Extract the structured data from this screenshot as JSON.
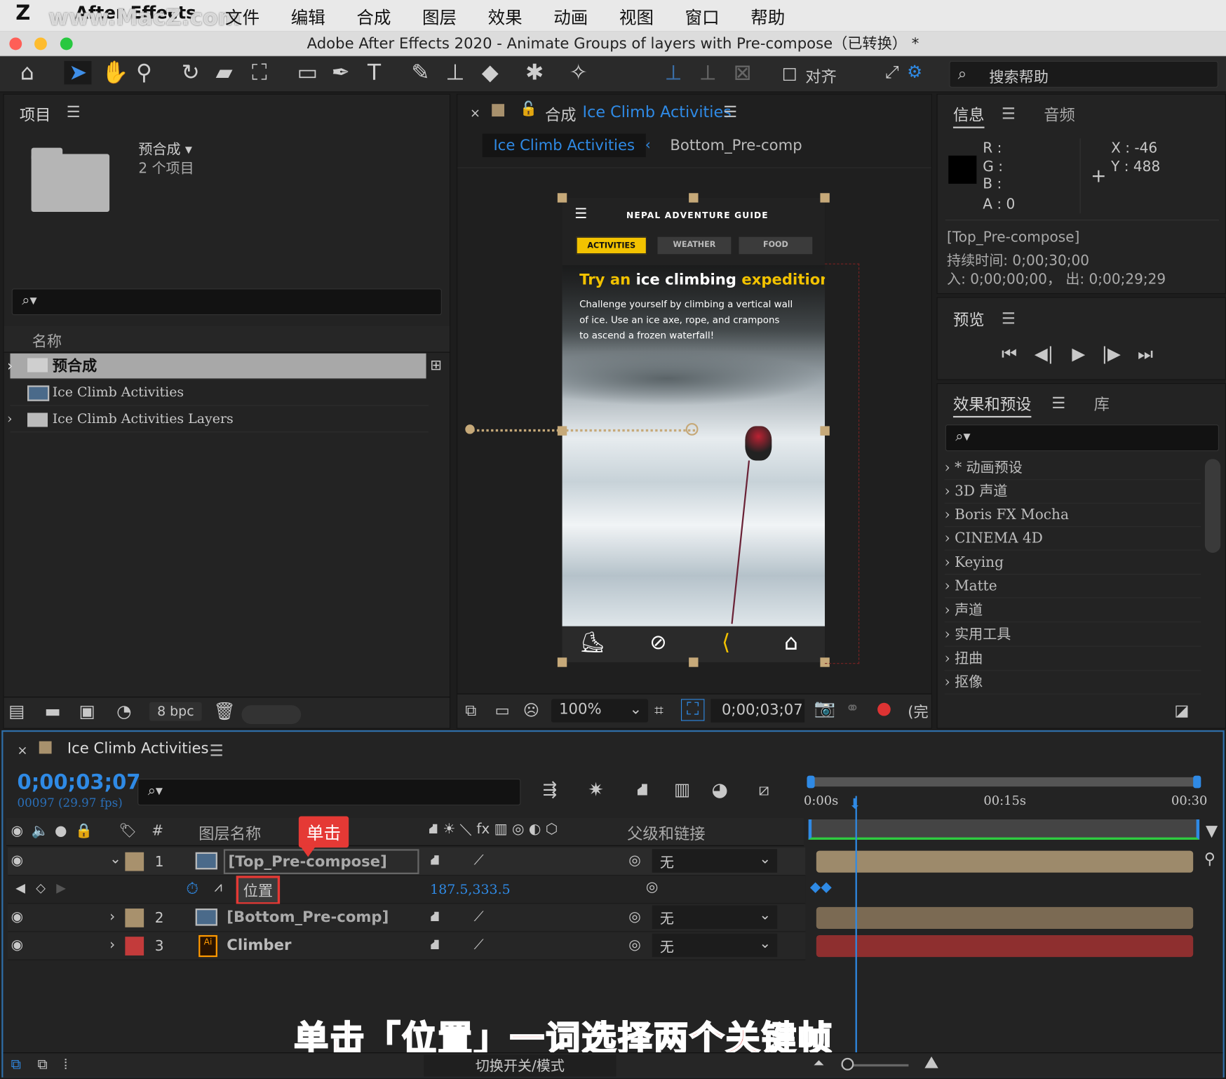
{
  "menubar": {
    "app": "After Effects",
    "watermark": "www.MacZ.com",
    "items": [
      "文件",
      "编辑",
      "合成",
      "图层",
      "效果",
      "动画",
      "视图",
      "窗口",
      "帮助"
    ]
  },
  "window": {
    "title": "Adobe After Effects 2020 - Animate Groups of layers with Pre-compose（已转换） *"
  },
  "toolbar": {
    "align_label": "对齐",
    "search_placeholder": "搜索帮助"
  },
  "project": {
    "title": "项目",
    "folder_name": "预合成 ▾",
    "folder_count": "2 个项目",
    "column_name": "名称",
    "items": [
      "预合成",
      "Ice Climb Activities",
      "Ice Climb Activities Layers"
    ],
    "bpc": "8 bpc"
  },
  "composition": {
    "title_prefix": "合成",
    "title_name": "Ice Climb Activities",
    "tabs": [
      "Ice Climb Activities",
      "Bottom_Pre-comp"
    ],
    "zoom": "100%",
    "timecode": "0;00;03;07",
    "quality": "(完"
  },
  "phone": {
    "header": "NEPAL ADVENTURE GUIDE",
    "tabs": [
      "ACTIVITIES",
      "WEATHER",
      "FOOD"
    ],
    "headline_parts": [
      "Try an",
      "ice climbing",
      "expedition"
    ],
    "body": [
      "Challenge yourself by climbing a vertical wall",
      "of ice. Use an ice axe, rope, and crampons",
      "to ascend a frozen waterfall!"
    ]
  },
  "info": {
    "tabs": [
      "信息",
      "音频"
    ],
    "r": "R :",
    "g": "G :",
    "b": "B :",
    "a": "A :  0",
    "x": "X : -46",
    "y": "Y :  488",
    "layer": "[Top_Pre-compose]",
    "duration": "持续时间: 0;00;30;00",
    "inout": "入: 0;00;00;00，  出: 0;00;29;29"
  },
  "preview": {
    "title": "预览"
  },
  "effects": {
    "tabs": [
      "效果和预设",
      "库"
    ],
    "items": [
      "* 动画预设",
      "3D 声道",
      "Boris FX Mocha",
      "CINEMA 4D",
      "Keying",
      "Matte",
      "声道",
      "实用工具",
      "扭曲",
      "抠像"
    ]
  },
  "timeline": {
    "title": "Ice Climb Activities",
    "timecode": "0;00;03;07",
    "frames": "00097 (29.97 fps)",
    "col_hash": "#",
    "col_layer": "图层名称",
    "col_parent": "父级和链接",
    "ruler": [
      "0:00s",
      "00:15s",
      "00:30"
    ],
    "layers": [
      {
        "num": "1",
        "name": "[Top_Pre-compose]",
        "parent": "无",
        "color": "#a8916d"
      },
      {
        "num": "2",
        "name": "[Bottom_Pre-comp]",
        "parent": "无",
        "color": "#a8916d"
      },
      {
        "num": "3",
        "name": "Climber",
        "parent": "无",
        "color": "#c33b3b"
      }
    ],
    "property": {
      "name": "位置",
      "value": "187.5,333.5"
    },
    "callout": "单击",
    "caption": "单击「位置」一词选择两个关键帧",
    "footer": "切换开关/模式"
  }
}
